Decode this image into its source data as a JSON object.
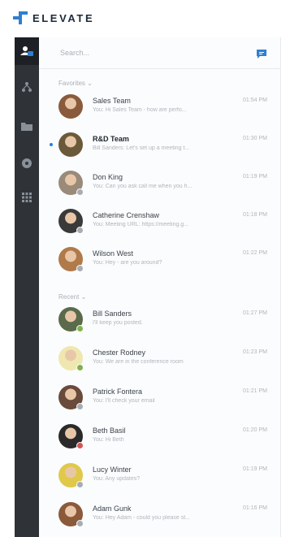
{
  "brand": {
    "name": "ELEVATE"
  },
  "colors": {
    "sidebar": "#2f3338",
    "accent": "#2f7fd1",
    "presence_green": "#7fb24a",
    "presence_gray": "#a6adb4",
    "presence_red": "#d9534f"
  },
  "nav": [
    {
      "icon": "contacts-icon",
      "active": true
    },
    {
      "icon": "org-chart-icon",
      "active": false
    },
    {
      "icon": "folder-icon",
      "active": false
    },
    {
      "icon": "help-icon",
      "active": false
    },
    {
      "icon": "apps-grid-icon",
      "active": false
    }
  ],
  "search": {
    "placeholder": "Search..."
  },
  "sections": {
    "favorites": "Favorites",
    "recent": "Recent"
  },
  "favorites": [
    {
      "name": "Sales Team",
      "preview": "You: Hi Sales Team - how are perfo...",
      "time": "01:54 PM",
      "unread": false,
      "presence": null,
      "avatar_color": "#8a5a3c"
    },
    {
      "name": "R&D Team",
      "preview": "Bill Sanders: Let's set up a meeting t...",
      "time": "01:30 PM",
      "unread": true,
      "presence": null,
      "avatar_color": "#6b5a3a"
    },
    {
      "name": "Don King",
      "preview": "You: Can you ask call me when you h...",
      "time": "01:19 PM",
      "unread": false,
      "presence": "gray",
      "avatar_color": "#9a8a7a"
    },
    {
      "name": "Catherine Crenshaw",
      "preview": "You: Meeting URL: https://meeting.g...",
      "time": "01:18 PM",
      "unread": false,
      "presence": "gray",
      "avatar_color": "#3a3a3a"
    },
    {
      "name": "Wilson West",
      "preview": "You: Hey - are you around?",
      "time": "01:22 PM",
      "unread": false,
      "presence": "gray",
      "avatar_color": "#b07a4a"
    }
  ],
  "recent": [
    {
      "name": "Bill Sanders",
      "preview": "I'll keep you posted.",
      "time": "01:27 PM",
      "unread": false,
      "presence": "green",
      "avatar_color": "#5a6a4a"
    },
    {
      "name": "Chester Rodney",
      "preview": "You: We are in the conference room",
      "time": "01:23 PM",
      "unread": false,
      "presence": "green",
      "avatar_color": "#efe7b0"
    },
    {
      "name": "Patrick Fontera",
      "preview": "You: I'll check your email",
      "time": "01:21 PM",
      "unread": false,
      "presence": "gray",
      "avatar_color": "#6a4a3a"
    },
    {
      "name": "Beth Basil",
      "preview": "You: Hi Beth",
      "time": "01:20 PM",
      "unread": false,
      "presence": "red",
      "avatar_color": "#2a2a2a"
    },
    {
      "name": "Lucy Winter",
      "preview": "You: Any updates?",
      "time": "01:19 PM",
      "unread": false,
      "presence": "gray",
      "avatar_color": "#e0c84a"
    },
    {
      "name": "Adam Gunk",
      "preview": "You: Hey Adam - could you please st...",
      "time": "01:16 PM",
      "unread": false,
      "presence": "gray",
      "avatar_color": "#8a5a3a"
    }
  ]
}
